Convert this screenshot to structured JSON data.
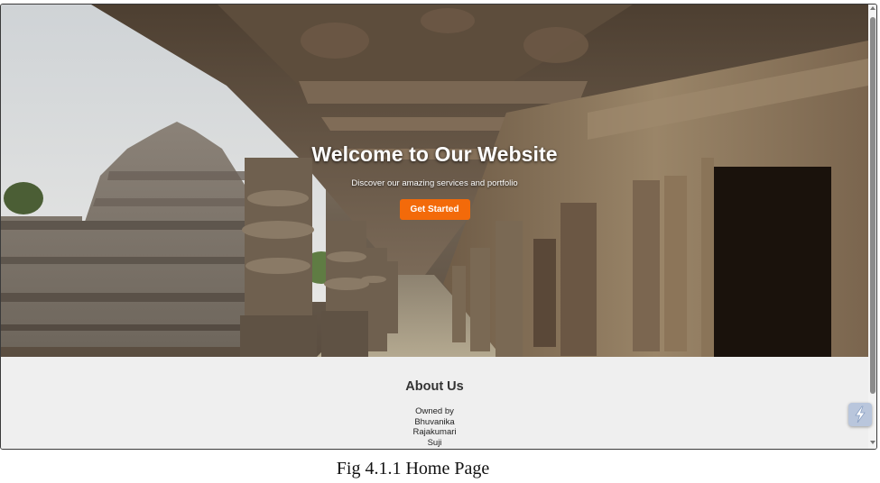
{
  "hero": {
    "title": "Welcome to Our Website",
    "subtitle": "Discover our amazing services and portfolio",
    "cta_label": "Get Started",
    "cta_color": "#f36a0a"
  },
  "about": {
    "heading": "About Us",
    "owner_label": "Owned by",
    "owners": [
      "Bhuvanika",
      "Rajakumari",
      "Suji"
    ]
  },
  "caption": "Fig 4.1.1 Home Page",
  "icons": {
    "floating_widget": "lightning-icon",
    "scroll_up": "scroll-up-arrow-icon",
    "scroll_down": "scroll-down-arrow-icon"
  }
}
